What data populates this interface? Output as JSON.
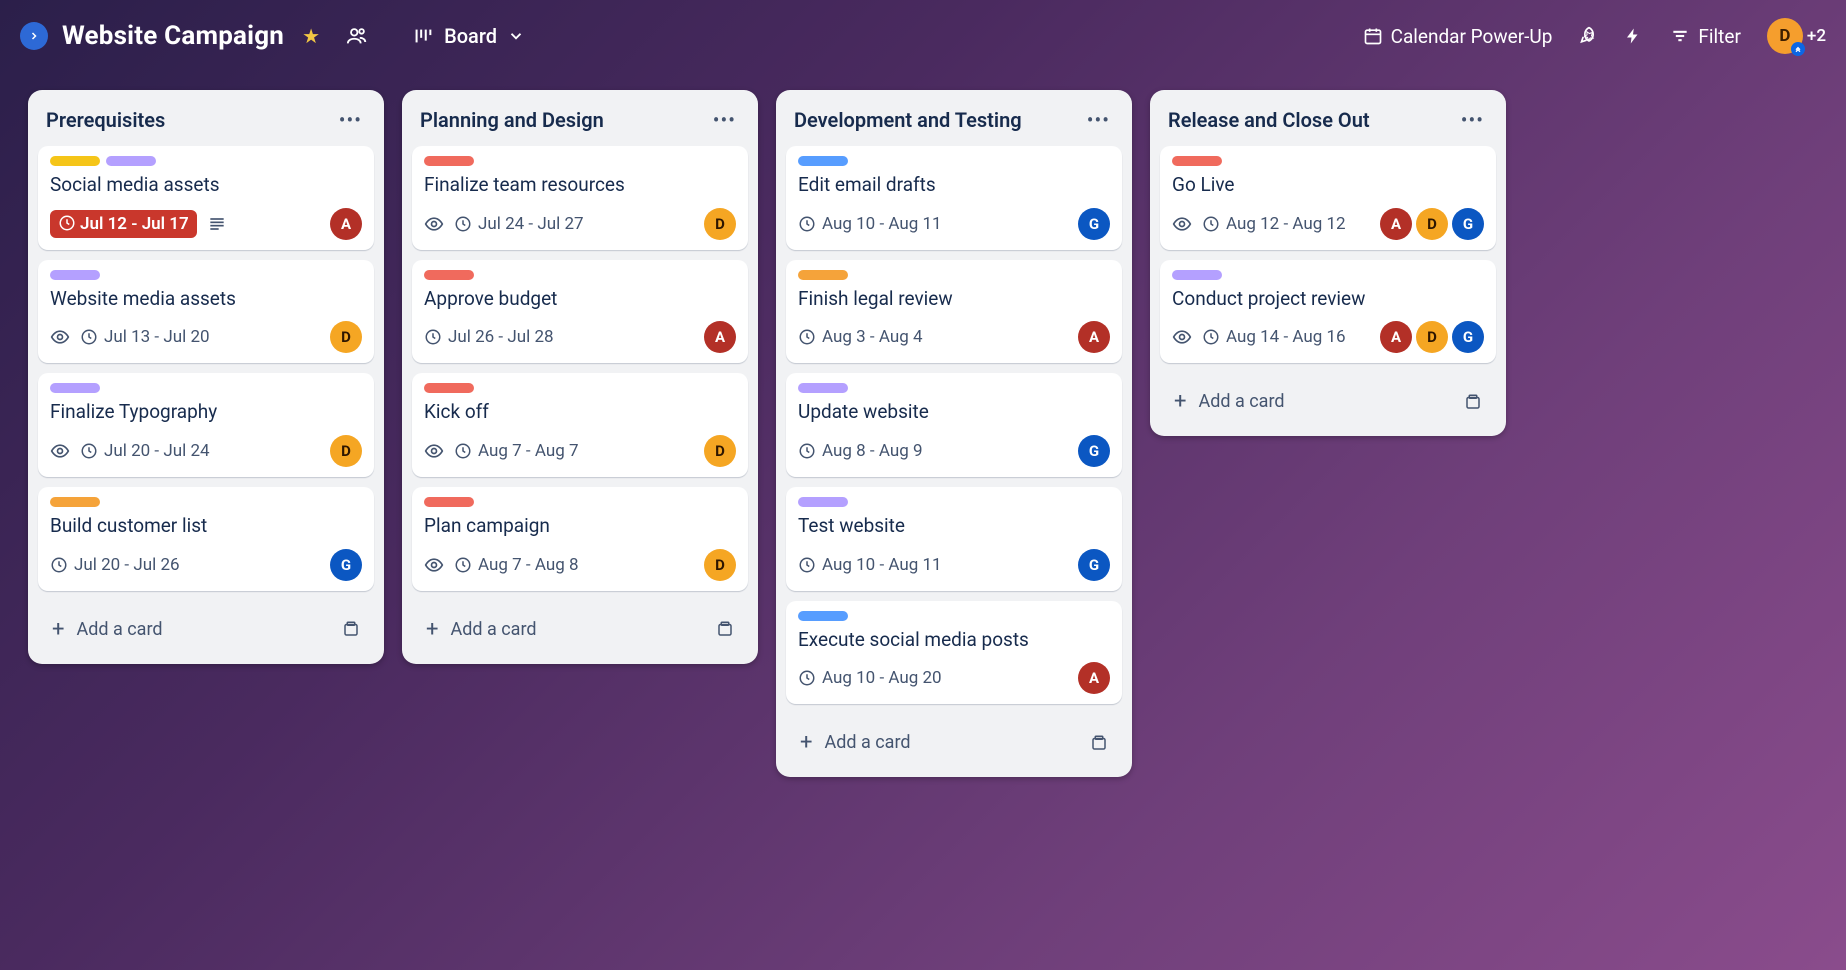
{
  "header": {
    "board_title": "Website Campaign",
    "view_label": "Board",
    "calendar_label": "Calendar Power-Up",
    "filter_label": "Filter",
    "member_initial": "D",
    "member_count": "+2"
  },
  "add_card_label": "Add a card",
  "lists": [
    {
      "title": "Prerequisites"
    },
    {
      "title": "Planning and Design"
    },
    {
      "title": "Development and Testing"
    },
    {
      "title": "Release and Close Out"
    }
  ],
  "c": {
    "l0c0": {
      "title": "Social media assets",
      "date": "Jul 12 - Jul 17"
    },
    "l0c1": {
      "title": "Website media assets",
      "date": "Jul 13 - Jul 20"
    },
    "l0c2": {
      "title": "Finalize Typography",
      "date": "Jul 20 - Jul 24"
    },
    "l0c3": {
      "title": "Build customer list",
      "date": "Jul 20 - Jul 26"
    },
    "l1c0": {
      "title": "Finalize team resources",
      "date": "Jul 24 - Jul 27"
    },
    "l1c1": {
      "title": "Approve budget",
      "date": "Jul 26 - Jul 28"
    },
    "l1c2": {
      "title": "Kick off",
      "date": "Aug 7 - Aug 7"
    },
    "l1c3": {
      "title": "Plan campaign",
      "date": "Aug 7 - Aug 8"
    },
    "l2c0": {
      "title": "Edit email drafts",
      "date": "Aug 10 - Aug 11"
    },
    "l2c1": {
      "title": "Finish legal review",
      "date": "Aug 3 - Aug 4"
    },
    "l2c2": {
      "title": "Update website",
      "date": "Aug 8 - Aug 9"
    },
    "l2c3": {
      "title": "Test website",
      "date": "Aug 10 - Aug 11"
    },
    "l2c4": {
      "title": "Execute social media posts",
      "date": "Aug 10 - Aug 20"
    },
    "l3c0": {
      "title": "Go Live",
      "date": "Aug 12 - Aug 12"
    },
    "l3c1": {
      "title": "Conduct project review",
      "date": "Aug 14 - Aug 16"
    }
  },
  "avatar": {
    "A": "A",
    "D": "D",
    "G": "G"
  }
}
